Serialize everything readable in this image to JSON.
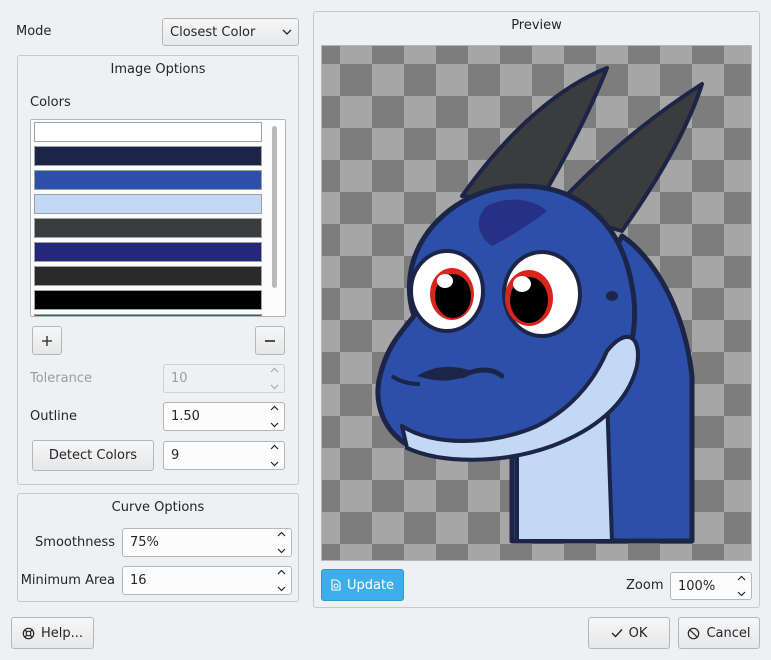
{
  "mode": {
    "label": "Mode",
    "value": "Closest Color"
  },
  "image_options": {
    "title": "Image Options",
    "colors_label": "Colors",
    "swatches": [
      "#ffffff",
      "#1c2547",
      "#2c4faa",
      "#c3d8f4",
      "#3a3c3e",
      "#25287a",
      "#2a2a2a",
      "#000000",
      "#d9261c"
    ],
    "tolerance": {
      "label": "Tolerance",
      "value": "10"
    },
    "outline": {
      "label": "Outline",
      "value": "1.50"
    },
    "detect_button": "Detect Colors",
    "detect_count": "9"
  },
  "curve_options": {
    "title": "Curve Options",
    "smoothness": {
      "label": "Smoothness",
      "value": "75%"
    },
    "min_area": {
      "label": "Minimum Area",
      "value": "16"
    }
  },
  "preview": {
    "title": "Preview",
    "update_button": "Update",
    "zoom_label": "Zoom",
    "zoom_value": "100%"
  },
  "footer": {
    "help": "Help...",
    "ok": "OK",
    "cancel": "Cancel"
  },
  "colors": {
    "accent": "#3daee9",
    "checker_dark": "#7d7d7d",
    "checker_light": "#a6a6a6"
  }
}
